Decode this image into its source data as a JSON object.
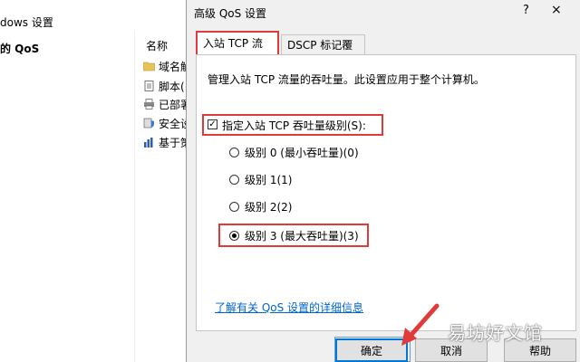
{
  "background_window": {
    "title": "dows 设置",
    "tree_label": "的 QoS",
    "column_header": "名称",
    "items": [
      {
        "label": "域名解",
        "icon": "folder-icon"
      },
      {
        "label": "脚本(",
        "icon": "script-icon"
      },
      {
        "label": "已部署",
        "icon": "printer-icon"
      },
      {
        "label": "安全设",
        "icon": "security-icon"
      },
      {
        "label": "基于策",
        "icon": "chart-icon"
      }
    ]
  },
  "dialog": {
    "title": "高级 QoS 设置",
    "help_glyph": "?",
    "close_glyph": "×",
    "tabs": [
      {
        "label": "入站 TCP 流量",
        "active": true
      },
      {
        "label": "DSCP 标记覆盖",
        "active": false
      }
    ],
    "description": "管理入站 TCP 流量的吞吐量。此设置应用于整个计算机。",
    "specify_checkbox": {
      "label": "指定入站 TCP 吞吐量级别(S):",
      "checked": true,
      "glyph": "✓"
    },
    "levels": [
      {
        "label": "级别 0 (最小吞吐量)(0)",
        "checked": false
      },
      {
        "label": "级别 1(1)",
        "checked": false
      },
      {
        "label": "级别 2(2)",
        "checked": false
      },
      {
        "label": "级别 3 (最大吞吐量)(3)",
        "checked": true
      }
    ],
    "learn_more_link": "了解有关 QoS 设置的详细信息",
    "buttons": {
      "ok": "确定",
      "cancel": "取消",
      "help": "帮助"
    }
  },
  "watermark": "易坊好文馆",
  "colors": {
    "highlight": "#e03a3a",
    "link": "#0066cc",
    "dialog_bg": "#f0f0f0",
    "focus": "#0078d7"
  }
}
